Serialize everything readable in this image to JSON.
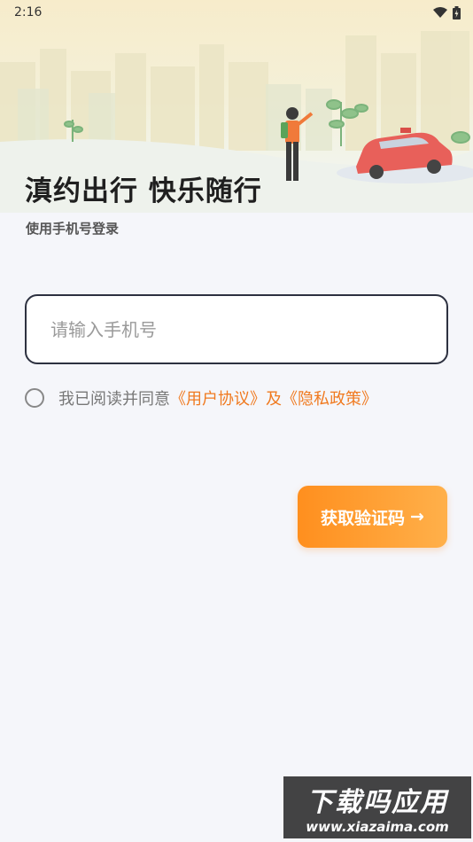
{
  "status_bar": {
    "time": "2:16",
    "icons": [
      "wifi-icon",
      "battery-icon"
    ]
  },
  "hero": {
    "title": "滇约出行 快乐随行",
    "subtitle": "使用手机号登录"
  },
  "phone_input": {
    "placeholder": "请输入手机号",
    "value": ""
  },
  "agreement": {
    "prefix": "我已阅读并同意",
    "user_agreement": "《用户协议》",
    "conjunction": "及",
    "privacy_policy": "《隐私政策》",
    "checked": false
  },
  "get_code_button": {
    "label": "获取验证码",
    "arrow": "→"
  },
  "watermark": {
    "title": "下载吗应用",
    "url": "www.xiazaima.com"
  },
  "colors": {
    "accent": "#f07a20",
    "button_start": "#ff8f1e",
    "button_end": "#ffb04a",
    "background": "#f5f6fa"
  }
}
